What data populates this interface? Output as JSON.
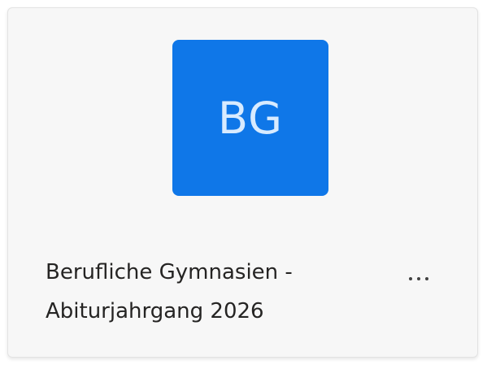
{
  "team_card": {
    "avatar": {
      "initials": "BG",
      "color": "#0f77e8",
      "text_color": "#d8ebff"
    },
    "name_lines": [
      "Berufliche Gymnasien -",
      "Abiturjahrgang 2026"
    ],
    "more_icon": "more-horizontal-icon"
  }
}
